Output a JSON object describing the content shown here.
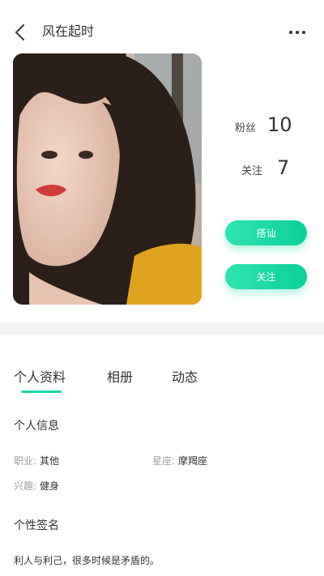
{
  "header": {
    "title": "风在起时",
    "back_icon": "chevron-left-icon",
    "more_icon": "more-horizontal-icon"
  },
  "stats": {
    "fans_label": "粉丝",
    "fans_value": "10",
    "follow_label": "关注",
    "follow_value": "7"
  },
  "actions": {
    "chat_label": "搭讪",
    "follow_label": "关注"
  },
  "tabs": [
    {
      "label": "个人资料",
      "active": true
    },
    {
      "label": "相册",
      "active": false
    },
    {
      "label": "动态",
      "active": false
    }
  ],
  "info": {
    "section_title": "个人信息",
    "job_label": "职业:",
    "job_value": "其他",
    "zodiac_label": "星座:",
    "zodiac_value": "摩羯座",
    "hobby_label": "兴趣:",
    "hobby_value": "健身"
  },
  "signature": {
    "section_title": "个性签名",
    "text": "利人与利己，很多时候是矛盾的。"
  },
  "colors": {
    "accent": "#18d6a5",
    "divider": "#f3f3f3",
    "muted_text": "#a0a0a0"
  }
}
